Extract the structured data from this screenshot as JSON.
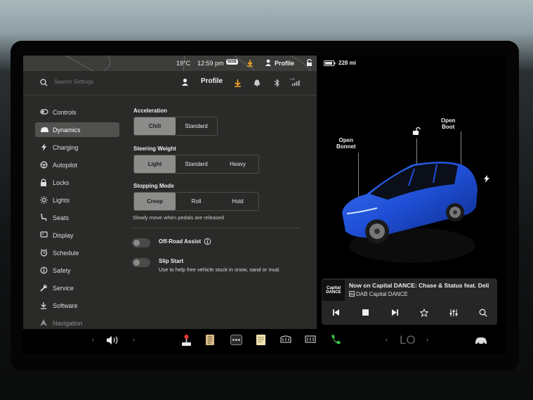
{
  "status_bar": {
    "temp": "19°C",
    "time": "12:59 pm",
    "sos_badge": "SOS",
    "profile": "Profile",
    "range": "228 mi"
  },
  "top_bar": {
    "search_placeholder": "Search Settings",
    "profile": "Profile"
  },
  "sidebar": {
    "items": [
      {
        "label": "Controls",
        "icon": "toggle-icon"
      },
      {
        "label": "Dynamics",
        "icon": "car-icon",
        "active": true
      },
      {
        "label": "Charging",
        "icon": "bolt-icon"
      },
      {
        "label": "Autopilot",
        "icon": "steering-wheel-icon"
      },
      {
        "label": "Locks",
        "icon": "lock-icon"
      },
      {
        "label": "Lights",
        "icon": "sun-icon"
      },
      {
        "label": "Seats",
        "icon": "seat-icon"
      },
      {
        "label": "Display",
        "icon": "display-icon"
      },
      {
        "label": "Schedule",
        "icon": "clock-icon"
      },
      {
        "label": "Safety",
        "icon": "info-icon"
      },
      {
        "label": "Service",
        "icon": "wrench-icon"
      },
      {
        "label": "Software",
        "icon": "download-icon"
      },
      {
        "label": "Navigation",
        "icon": "navigation-icon"
      }
    ]
  },
  "dynamics": {
    "acceleration": {
      "label": "Acceleration",
      "options": [
        "Chill",
        "Standard"
      ],
      "selected": "Chill"
    },
    "steering": {
      "label": "Steering Weight",
      "options": [
        "Light",
        "Standard",
        "Heavy"
      ],
      "selected": "Light"
    },
    "stopping": {
      "label": "Stopping Mode",
      "options": [
        "Creep",
        "Roll",
        "Hold"
      ],
      "selected": "Creep",
      "hint": "Slowly move when pedals are released"
    },
    "off_road": {
      "label": "Off-Road Assist",
      "on": false
    },
    "slip_start": {
      "label": "Slip Start",
      "desc": "Use to help free vehicle stuck in snow, sand or mud.",
      "on": false
    }
  },
  "car": {
    "open_bonnet": [
      "Open",
      "Bonnet"
    ],
    "open_boot": [
      "Open",
      "Boot"
    ]
  },
  "media": {
    "album_art": [
      "Capital",
      "DANCE"
    ],
    "track": "Now on Capital DANCE: Chase & Status feat. Deli",
    "station": "DAB Capital DANCE"
  },
  "dock": {
    "climate_temp": "LO"
  },
  "colors": {
    "accent_orange": "#f5a623",
    "phone_green": "#3cc94a",
    "car_blue": "#1f4fd6",
    "selected_segment": "#8c8c8a"
  }
}
